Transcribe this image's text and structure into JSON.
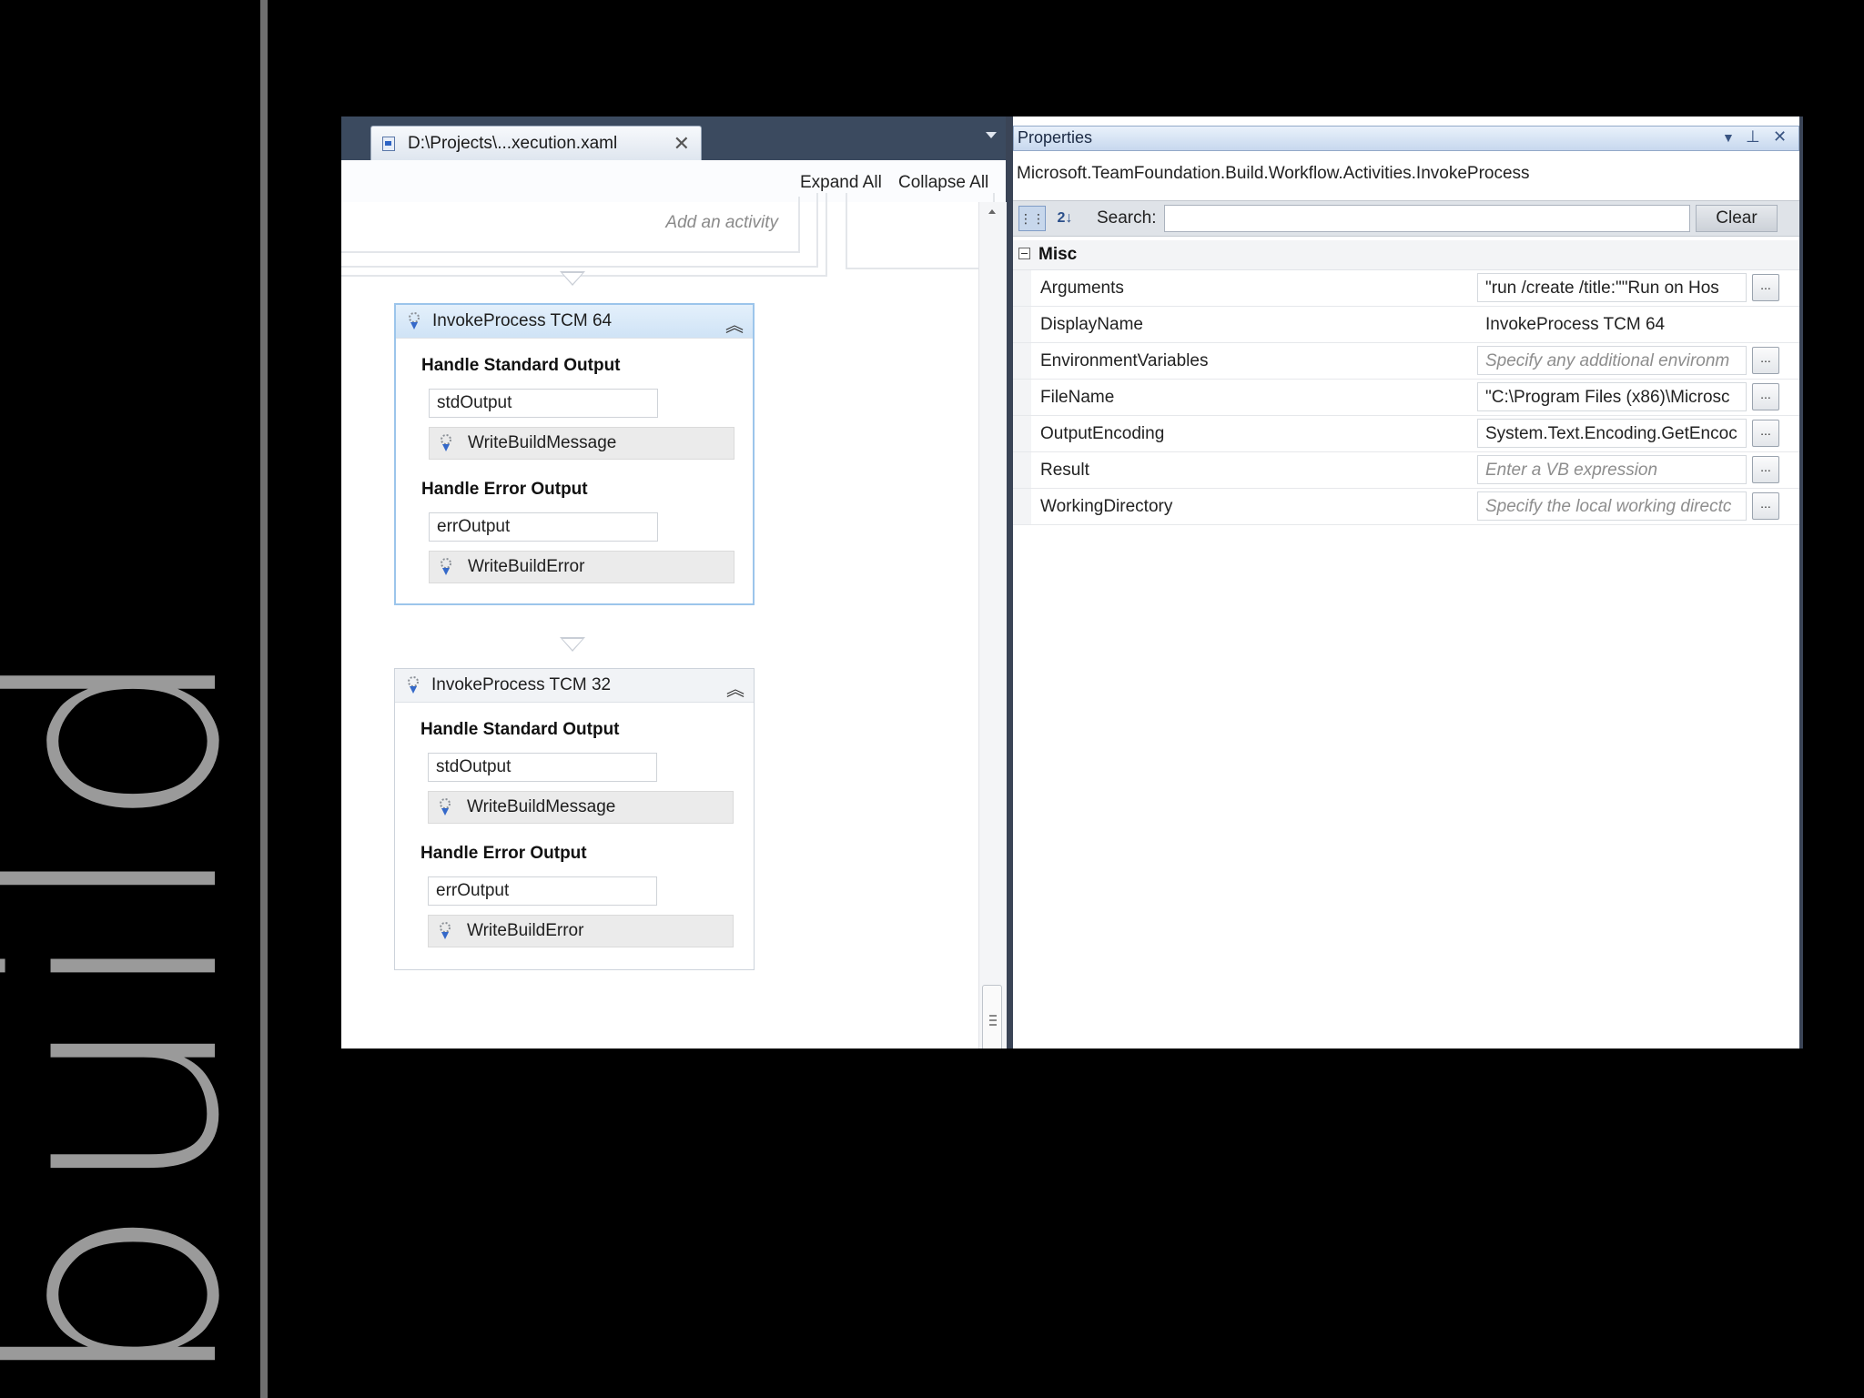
{
  "slide": {
    "side_word": "build"
  },
  "designer": {
    "tab_title": "D:\\Projects\\...xecution.xaml",
    "tab_close": "✕",
    "toolbar": {
      "expand_all": "Expand All",
      "collapse_all": "Collapse All"
    },
    "add_activity_hint": "Add an activity",
    "activities": [
      {
        "title": "InvokeProcess TCM 64",
        "std_label": "Handle Standard Output",
        "std_var": "stdOutput",
        "std_child": "WriteBuildMessage",
        "err_label": "Handle Error Output",
        "err_var": "errOutput",
        "err_child": "WriteBuildError"
      },
      {
        "title": "InvokeProcess TCM 32",
        "std_label": "Handle Standard Output",
        "std_var": "stdOutput",
        "std_child": "WriteBuildMessage",
        "err_label": "Handle Error Output",
        "err_var": "errOutput",
        "err_child": "WriteBuildError"
      }
    ],
    "collapse_glyph": "︽"
  },
  "properties": {
    "title": "Properties",
    "type_name": "Microsoft.TeamFoundation.Build.Workflow.Activities.InvokeProcess",
    "search_label": "Search:",
    "search_value": "",
    "clear_label": "Clear",
    "category": "Misc",
    "ellipsis": "...",
    "rows": [
      {
        "name": "Arguments",
        "value": "\"run /create /title:\"\"Run on Hos"
      },
      {
        "name": "DisplayName",
        "value": "InvokeProcess TCM 64"
      },
      {
        "name": "EnvironmentVariables",
        "value": "Specify any additional environm"
      },
      {
        "name": "FileName",
        "value": "\"C:\\Program Files (x86)\\Microsc"
      },
      {
        "name": "OutputEncoding",
        "value": "System.Text.Encoding.GetEncoc"
      },
      {
        "name": "Result",
        "value": "Enter a VB expression"
      },
      {
        "name": "WorkingDirectory",
        "value": "Specify the local working directc"
      }
    ]
  }
}
